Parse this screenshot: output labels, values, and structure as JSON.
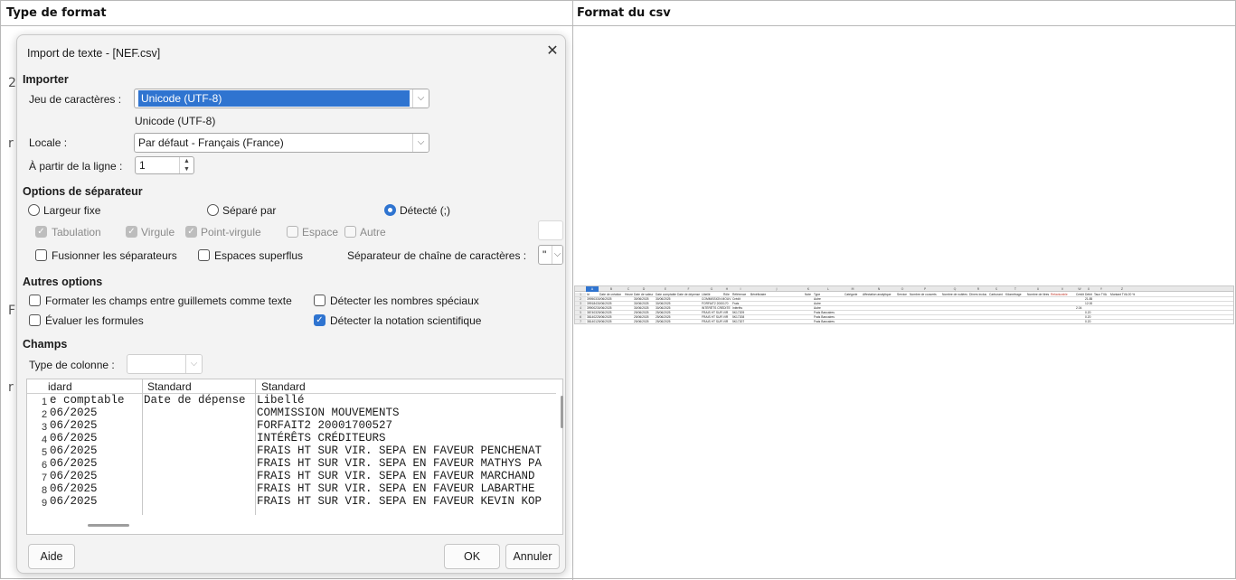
{
  "table_headers": {
    "left": "Type de format",
    "right": "Format du csv"
  },
  "dialog": {
    "title": "Import de texte - [NEF.csv]",
    "close_glyph": "✕",
    "importer": {
      "section": "Importer",
      "charset_label": "Jeu de caractères :",
      "charset_value": "Unicode (UTF-8)",
      "charset_dropdown_item": "Unicode (UTF-8)",
      "locale_label": "Locale :",
      "locale_value": "Par défaut - Français (France)",
      "from_line_label": "À partir de la ligne :",
      "from_line_value": "1"
    },
    "separator": {
      "section": "Options de séparateur",
      "fixed_width": "Largeur fixe",
      "separated_by": "Séparé par",
      "detected": "Détecté (;)",
      "tab": "Tabulation",
      "comma": "Virgule",
      "semicolon": "Point-virgule",
      "space": "Espace",
      "other": "Autre",
      "merge": "Fusionner les séparateurs",
      "trim": "Espaces superflus",
      "string_delim_label": "Séparateur de chaîne de caractères :",
      "string_delim_value": "\""
    },
    "other_options": {
      "section": "Autres options",
      "quoted_as_text": "Formater les champs entre guillemets comme texte",
      "detect_special": "Détecter les nombres spéciaux",
      "evaluate_formulas": "Évaluer les formules",
      "detect_scientific": "Détecter la notation scientifique"
    },
    "fields": {
      "section": "Champs",
      "column_type_label": "Type de colonne :",
      "column_type_value": ""
    },
    "preview": {
      "headers": [
        "idard",
        "Standard",
        "Standard"
      ],
      "rows": [
        {
          "n": "1",
          "c1": "e comptable",
          "c2": "Date de dépense",
          "c3": "Libellé"
        },
        {
          "n": "2",
          "c1": "06/2025",
          "c2": "",
          "c3": "COMMISSION MOUVEMENTS"
        },
        {
          "n": "3",
          "c1": "06/2025",
          "c2": "",
          "c3": "FORFAIT2 20001700527"
        },
        {
          "n": "4",
          "c1": "06/2025",
          "c2": "",
          "c3": "INTÉRÊTS CRÉDITEURS"
        },
        {
          "n": "5",
          "c1": "06/2025",
          "c2": "",
          "c3": "FRAIS HT SUR VIR. SEPA EN FAVEUR PENCHENAT"
        },
        {
          "n": "6",
          "c1": "06/2025",
          "c2": "",
          "c3": "FRAIS HT SUR VIR. SEPA EN FAVEUR MATHYS PA"
        },
        {
          "n": "7",
          "c1": "06/2025",
          "c2": "",
          "c3": "FRAIS HT SUR VIR. SEPA EN FAVEUR MARCHAND"
        },
        {
          "n": "8",
          "c1": "06/2025",
          "c2": "",
          "c3": "FRAIS HT SUR VIR. SEPA EN FAVEUR LABARTHE"
        },
        {
          "n": "9",
          "c1": "06/2025",
          "c2": "",
          "c3": "FRAIS HT SUR VIR. SEPA EN FAVEUR KEVIN KOP"
        }
      ]
    },
    "buttons": {
      "help": "Aide",
      "ok": "OK",
      "cancel": "Annuler"
    }
  },
  "background_letters": [
    "2",
    "r",
    "F",
    "r"
  ],
  "sheet": {
    "columns": [
      "A",
      "B",
      "C",
      "D",
      "E",
      "F",
      "G",
      "H",
      "I",
      "J",
      "K",
      "L",
      "M",
      "N",
      "O",
      "P",
      "Q",
      "R",
      "S",
      "T",
      "U",
      "V",
      "W",
      "X",
      "Y",
      "Z"
    ],
    "header_row": [
      "Id",
      "Date de création",
      "Heure",
      "Date de valeur",
      "Date comptable",
      "Date de dépense",
      "Libellé",
      "Rôle",
      "Référence",
      "Bénéficiaire",
      "Note",
      "Type",
      "Catégorie",
      "Affectation analytique",
      "Service",
      "Nombre de couverts",
      "Nombre de nuitées",
      "Dîners inclus",
      "Carburant",
      "Kilométrage",
      "Nombre de litres",
      "Refacturable",
      "Crédit",
      "Débit",
      "Taux TVA",
      "Montant TVA 20 %"
    ],
    "rows": [
      {
        "n": "2",
        "id": "399503",
        "created": "30/06/2025",
        "value_date": "30/06/2025",
        "acct_date": "30/06/2025",
        "label": "COMMISSION MOUV",
        "role": "Crédit",
        "type": "Autre",
        "credit": "",
        "debit": "21.85"
      },
      {
        "n": "3",
        "id": "399184",
        "created": "30/06/2025",
        "value_date": "30/06/2025",
        "acct_date": "30/06/2025",
        "label": "FORFAIT2 2000170",
        "role": "Frais",
        "type": "Autre",
        "credit": "",
        "debit": "12.00"
      },
      {
        "n": "4",
        "id": "399002",
        "created": "30/06/2025",
        "value_date": "30/06/2025",
        "acct_date": "30/06/2025",
        "label": "INTÉRÊTS CRÉDITE",
        "role": "Intérêts",
        "type": "Autre",
        "credit": "2.04",
        "debit": ""
      },
      {
        "n": "5",
        "id": "387403",
        "created": "25/06/2025",
        "value_date": "25/06/2025",
        "acct_date": "25/06/2025",
        "label": "FRAIS HT SUR VIR",
        "role": "5K17209",
        "type": "Frais Bancaires",
        "credit": "",
        "debit": "0.20"
      },
      {
        "n": "6",
        "id": "381402",
        "created": "25/06/2025",
        "value_date": "25/06/2025",
        "acct_date": "25/06/2025",
        "label": "FRAIS HT SUR VIR",
        "role": "5K17208",
        "type": "Frais Bancaires",
        "credit": "",
        "debit": "0.20"
      },
      {
        "n": "7",
        "id": "381401",
        "created": "25/06/2025",
        "value_date": "25/06/2025",
        "acct_date": "25/06/2025",
        "label": "FRAIS HT SUR VIR",
        "role": "5K17207",
        "type": "Frais Bancaires",
        "credit": "",
        "debit": "0.20"
      }
    ]
  }
}
